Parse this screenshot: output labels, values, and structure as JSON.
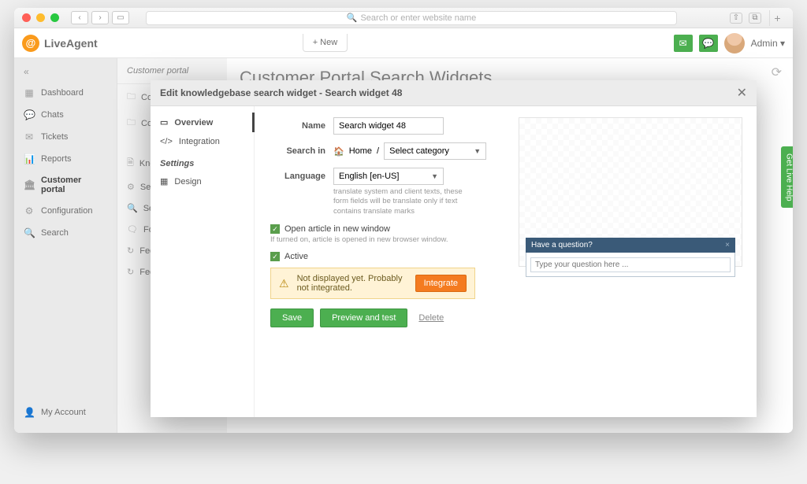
{
  "browser": {
    "placeholder": "Search or enter website name"
  },
  "header": {
    "app_name": "LiveAgent",
    "new_label": "+  New",
    "admin_label": "Admin ▾"
  },
  "sidebar": {
    "items": [
      {
        "label": "Dashboard"
      },
      {
        "label": "Chats"
      },
      {
        "label": "Tickets"
      },
      {
        "label": "Reports"
      },
      {
        "label": "Customer portal"
      },
      {
        "label": "Configuration"
      },
      {
        "label": "Search"
      }
    ],
    "account": "My Account"
  },
  "panel2": {
    "title": "Customer portal",
    "items": [
      {
        "label": "Com"
      },
      {
        "label": "Com"
      },
      {
        "label": ""
      },
      {
        "label": "Kno"
      },
      {
        "label": "Setti"
      },
      {
        "label": "Sear"
      },
      {
        "label": "Foru"
      },
      {
        "label": "Feed"
      },
      {
        "label": "Feed"
      }
    ]
  },
  "main": {
    "title": "Customer Portal Search Widgets"
  },
  "modal": {
    "title": "Edit knowledgebase search widget - Search widget 48",
    "left": {
      "overview": "Overview",
      "integration": "Integration",
      "settings_head": "Settings",
      "design": "Design"
    },
    "form": {
      "name_label": "Name",
      "name_value": "Search widget 48",
      "searchin_label": "Search in",
      "home": "Home",
      "slash": "/",
      "category": "Select category",
      "language_label": "Language",
      "language_value": "English [en-US]",
      "language_help": "translate system and client texts, these form fields will be translate only if text contains translate marks",
      "open_new": "Open article in new window",
      "open_new_help": "If turned on, article is opened in new browser window.",
      "active": "Active",
      "warn_text": "Not displayed yet. Probably not integrated.",
      "integrate": "Integrate",
      "save": "Save",
      "preview": "Preview and test",
      "delete": "Delete"
    },
    "widget": {
      "title": "Have a question?",
      "placeholder": "Type your question here ..."
    }
  },
  "live_help": "Get Live Help"
}
